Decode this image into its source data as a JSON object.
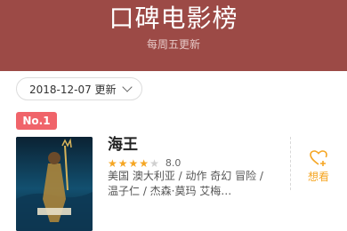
{
  "header": {
    "title": "口碑电影榜",
    "subtitle": "每周五更新"
  },
  "date_selector": {
    "value": "2018-12-07 更新"
  },
  "movies": [
    {
      "rank": "No.1",
      "title": "海王",
      "rating": 8.0,
      "stars_filled": 4,
      "stars_total": 5,
      "description": "美国 澳大利亚 / 动作 奇幻 冒险 / 温子仁 / 杰森·莫玛 艾梅…",
      "want_label": "想看",
      "poster_icon": "movie-poster-aquaman"
    }
  ],
  "colors": {
    "header_bg": "#9c4a46",
    "rank_badge": "#f0646a",
    "star": "#f5a623",
    "want": "#f5a623"
  }
}
